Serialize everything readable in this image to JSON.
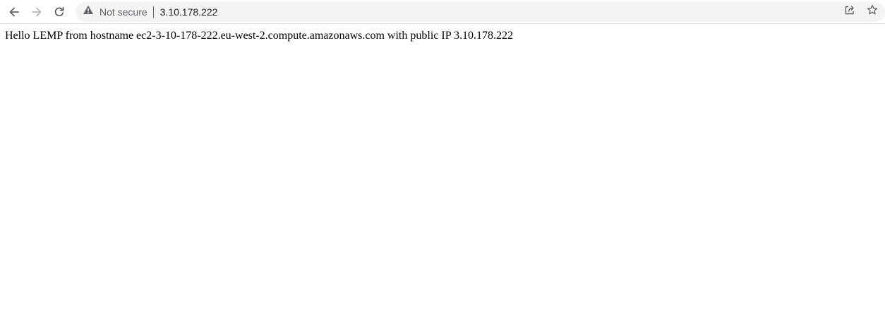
{
  "browser": {
    "security_label": "Not secure",
    "url": "3.10.178.222",
    "icons": {
      "back": "arrow-left-icon",
      "forward": "arrow-right-icon",
      "reload": "reload-icon",
      "security": "warning-triangle-icon",
      "share": "share-icon",
      "bookmark": "star-icon"
    }
  },
  "page": {
    "body_text": "Hello LEMP from hostname ec2-3-10-178-222.eu-west-2.compute.amazonaws.com with public IP 3.10.178.222"
  }
}
